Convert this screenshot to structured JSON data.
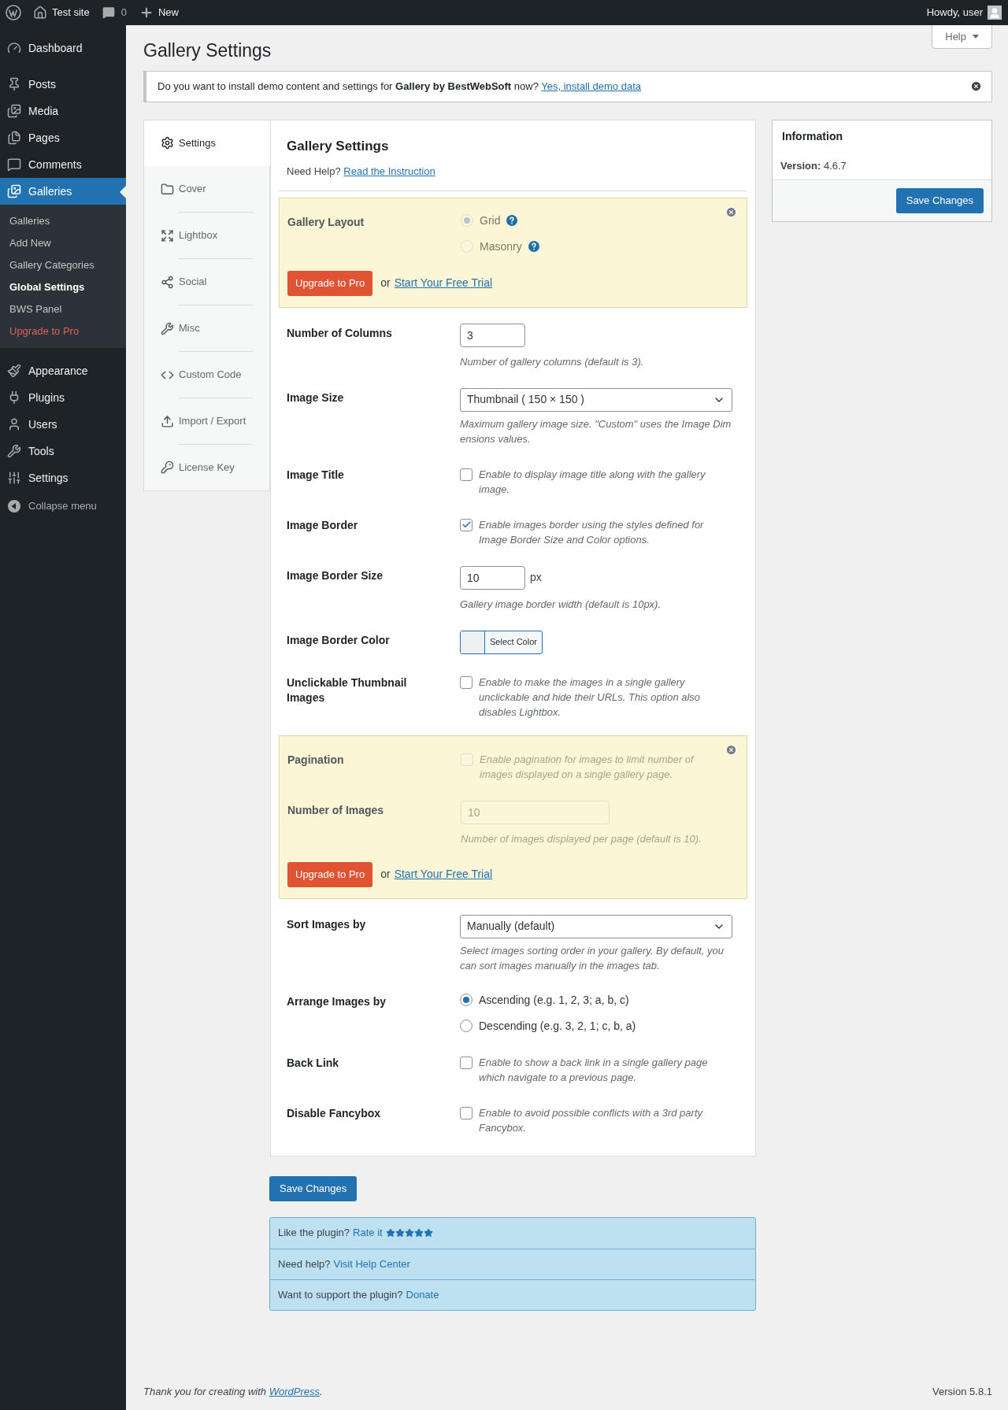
{
  "admin_bar": {
    "site": "Test site",
    "comments": "0",
    "new": "New",
    "greeting": "Howdy, user"
  },
  "sidebar": {
    "items": [
      {
        "label": "Dashboard",
        "selected": false
      },
      {
        "label": "Posts",
        "selected": false
      },
      {
        "label": "Media",
        "selected": false
      },
      {
        "label": "Pages",
        "selected": false
      },
      {
        "label": "Comments",
        "selected": false
      },
      {
        "label": "Galleries",
        "selected": true,
        "children": [
          {
            "label": "Galleries",
            "selected": false,
            "kind": "link"
          },
          {
            "label": "Add New",
            "selected": false,
            "kind": "link"
          },
          {
            "label": "Gallery Categories",
            "selected": false,
            "kind": "link"
          },
          {
            "label": "Global Settings",
            "selected": true,
            "kind": "link"
          },
          {
            "label": "BWS Panel",
            "selected": false,
            "kind": "link"
          },
          {
            "label": "Upgrade to Pro",
            "selected": false,
            "kind": "upgrade"
          }
        ]
      },
      {
        "label": "Appearance",
        "selected": false
      },
      {
        "label": "Plugins",
        "selected": false
      },
      {
        "label": "Users",
        "selected": false
      },
      {
        "label": "Tools",
        "selected": false
      },
      {
        "label": "Settings",
        "selected": false
      }
    ],
    "collapse": "Collapse menu"
  },
  "page": {
    "title": "Gallery Settings",
    "help_button": "Help"
  },
  "notice": {
    "text": "Do you want to install demo content and settings for **Gallery by BestWebSoft** now?",
    "link": "Yes, install demo data"
  },
  "tabs": [
    {
      "label": "Settings",
      "selected": true
    },
    {
      "label": "Cover",
      "selected": false
    },
    {
      "label": "Lightbox",
      "selected": false
    },
    {
      "label": "Social",
      "selected": false
    },
    {
      "label": "Misc",
      "selected": false
    },
    {
      "label": "Custom Code",
      "selected": false
    },
    {
      "label": "Import / Export",
      "selected": false
    },
    {
      "label": "License Key",
      "selected": false
    }
  ],
  "panel": {
    "title": "Gallery Settings",
    "help_text": "Need Help?",
    "help_link": "Read the Instruction"
  },
  "sections": [
    {
      "kind": "pro",
      "disabled": true,
      "upgrade": "Upgrade to Pro",
      "or": "or",
      "trial": "Start Your Free Trial",
      "rows": [
        {
          "kind": "radios",
          "label": "Gallery Layout",
          "options": [
            {
              "label": "Grid",
              "selected": true,
              "help": true
            },
            {
              "label": "Masonry",
              "selected": false,
              "help": true
            }
          ]
        }
      ]
    },
    {
      "kind": "row",
      "row": {
        "kind": "number",
        "label": "Number of Columns",
        "value": "3",
        "description": "Number of gallery columns (default is 3)."
      }
    },
    {
      "kind": "row",
      "row": {
        "kind": "select",
        "label": "Image Size",
        "value": "Thumbnail ( 150 × 150 )",
        "description": "Maximum gallery image size. \"Custom\" uses the Image Dim ensions values."
      }
    },
    {
      "kind": "row",
      "row": {
        "kind": "checkbox",
        "label": "Image Title",
        "checked": false,
        "description": "Enable to display image title along with the gallery image."
      }
    },
    {
      "kind": "row",
      "row": {
        "kind": "checkbox",
        "label": "Image Border",
        "checked": true,
        "description": "Enable images border using the styles defined for Image Border Size and Color options."
      }
    },
    {
      "kind": "row",
      "row": {
        "kind": "number",
        "label": "Image Border Size",
        "value": "10",
        "unit": "px",
        "description": "Gallery image border width (default is 10px)."
      }
    },
    {
      "kind": "row",
      "row": {
        "kind": "color",
        "label": "Image Border Color",
        "button": "Select Color"
      }
    },
    {
      "kind": "row",
      "row": {
        "kind": "checkbox",
        "label": "Unclickable Thumbnail Images",
        "checked": false,
        "description": "Enable to make the images in a single gallery unclickable and hide their URLs. This option also disables Lightbox."
      }
    },
    {
      "kind": "pro",
      "disabled": true,
      "upgrade": "Upgrade to Pro",
      "or": "or",
      "trial": "Start Your Free Trial",
      "rows": [
        {
          "kind": "checkbox",
          "label": "Pagination",
          "checked": false,
          "description": "Enable pagination for images to limit number of images displayed on a single gallery page."
        },
        {
          "kind": "wide",
          "label": "Number of Images",
          "value": "10",
          "description": "Number of images displayed per page (default is 10)."
        }
      ]
    },
    {
      "kind": "row",
      "row": {
        "kind": "select",
        "label": "Sort Images by",
        "value": "Manually (default)",
        "description": "Select images sorting order in your gallery. By default, you can sort images manually in the images tab."
      }
    },
    {
      "kind": "row",
      "row": {
        "kind": "radios",
        "label": "Arrange Images by",
        "options": [
          {
            "label": "Ascending (e.g. 1, 2, 3; a, b, c)",
            "selected": true,
            "help": false
          },
          {
            "label": "Descending (e.g. 3, 2, 1; c, b, a)",
            "selected": false,
            "help": false
          }
        ]
      }
    },
    {
      "kind": "row",
      "row": {
        "kind": "checkbox",
        "label": "Back Link",
        "checked": false,
        "description": "Enable to show a back link in a single gallery page which navigate to a previous page."
      }
    },
    {
      "kind": "row",
      "row": {
        "kind": "checkbox",
        "label": "Disable Fancybox",
        "checked": false,
        "description": "Enable to avoid possible conflicts with a 3rd party Fancybox."
      }
    }
  ],
  "save_button": "Save Changes",
  "info": {
    "title": "Information",
    "version_label": "Version:",
    "version": "4.6.7",
    "save_button": "Save Changes"
  },
  "links": [
    {
      "text": "Like the plugin?",
      "link": "Rate it",
      "stars": 5
    },
    {
      "text": "Need help?",
      "link": "Visit Help Center"
    },
    {
      "text": "Want to support the plugin?",
      "link": "Donate"
    }
  ],
  "footer": {
    "text": "Thank you for creating with",
    "link": "WordPress",
    "after": ".",
    "version": "Version 5.8.1"
  }
}
